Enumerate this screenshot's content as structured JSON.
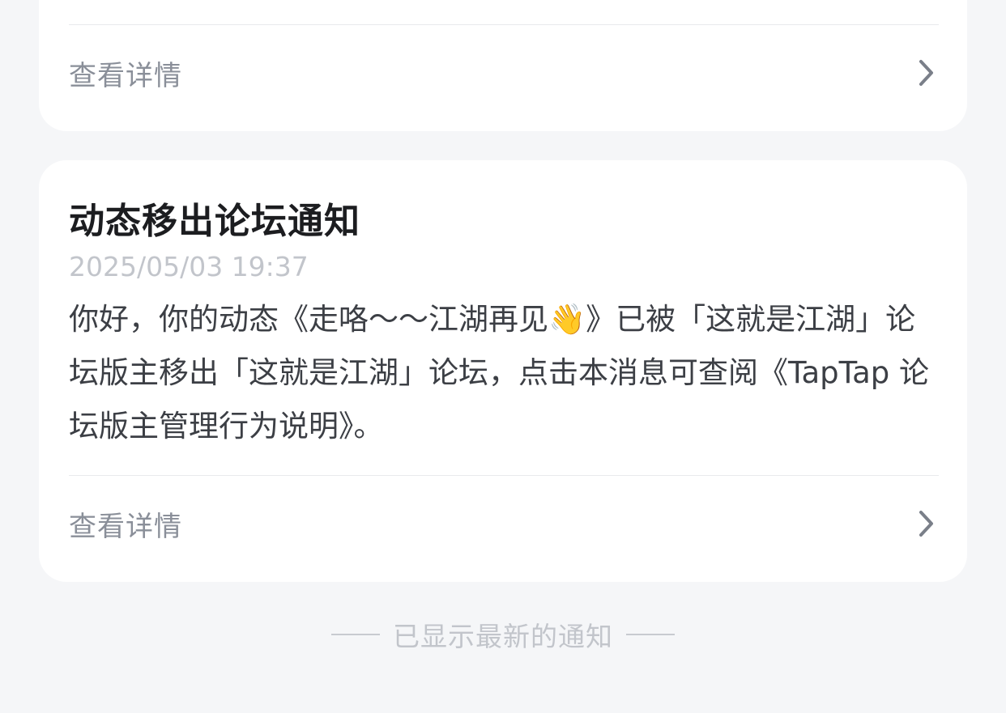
{
  "top_card": {
    "details_label": "查看详情"
  },
  "notification": {
    "title": "动态移出论坛通知",
    "timestamp": "2025/05/03 19:37",
    "body": "你好，你的动态《走咯～～江湖再见👋》已被「这就是江湖」论坛版主移出「这就是江湖」论坛，点击本消息可查阅《TapTap 论坛版主管理行为说明》。",
    "details_label": "查看详情"
  },
  "footer": {
    "text": "已显示最新的通知"
  },
  "icons": {
    "chevron": "chevron-right-icon"
  },
  "colors": {
    "background": "#f5f6f8",
    "card": "#ffffff",
    "title": "#1c1d20",
    "muted": "#8a8f99",
    "faint": "#c2c5cb"
  }
}
